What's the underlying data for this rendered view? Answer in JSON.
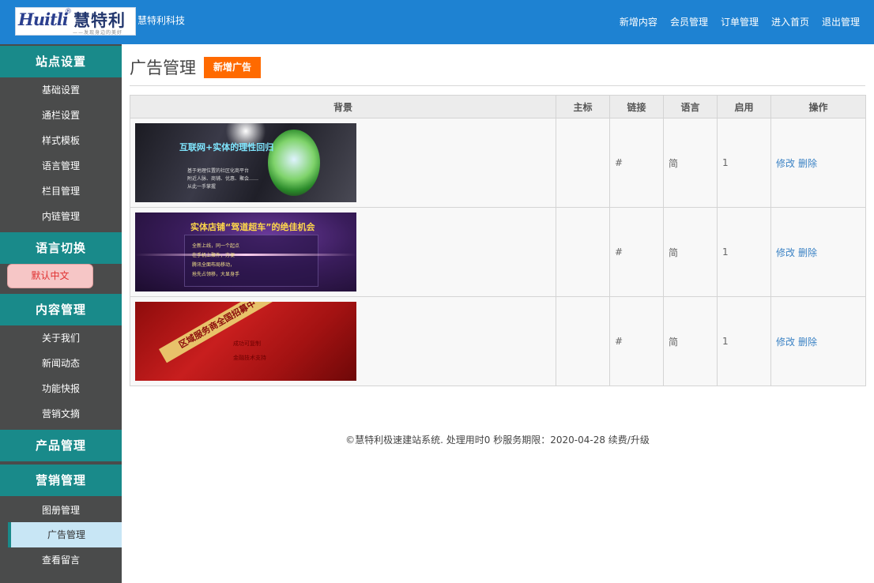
{
  "header": {
    "logo": {
      "script": "Huitli",
      "reg": "®",
      "name": "慧特利",
      "slogan": "——发现身边的美好"
    },
    "brand": "慧特利科技",
    "nav": [
      "新增内容",
      "会员管理",
      "订单管理",
      "进入首页",
      "退出管理"
    ]
  },
  "sidebar": {
    "site_settings": {
      "title": "站点设置",
      "items": [
        "基础设置",
        "通栏设置",
        "样式模板",
        "语言管理",
        "栏目管理",
        "内链管理"
      ]
    },
    "language": {
      "title": "语言切换",
      "button": "默认中文"
    },
    "content": {
      "title": "内容管理",
      "items": [
        "关于我们",
        "新闻动态",
        "功能快报",
        "营销文摘"
      ]
    },
    "product": {
      "title": "产品管理"
    },
    "marketing": {
      "title": "营销管理",
      "items": [
        "图册管理",
        "广告管理",
        "查看留言"
      ],
      "active": "广告管理"
    }
  },
  "main": {
    "title": "广告管理",
    "add_button": "新增广告",
    "table": {
      "headers": [
        "背景",
        "主标",
        "链接",
        "语言",
        "启用",
        "操作"
      ],
      "rows": [
        {
          "banner": {
            "headline": "互联网+实体的理性回归",
            "lines": [
              "基于地理位置的社区化商平台",
              "附近人脉、商铺、优惠、聚会……",
              "从此一手掌握"
            ]
          },
          "title": "",
          "link": "#",
          "lang": "简",
          "enabled": "1",
          "edit": "修改",
          "delete": "删除"
        },
        {
          "banner": {
            "headline": "实体店铺“驾道超车”的绝佳机会",
            "lines": [
              "全新上线，同一个起点",
              "在手机上聚件，方便",
              "腾讯全面布局移动，",
              "抢先占领移，大显身手"
            ]
          },
          "title": "",
          "link": "#",
          "lang": "简",
          "enabled": "1",
          "edit": "修改",
          "delete": "删除"
        },
        {
          "banner": {
            "headline": "区域服务商全国招募中",
            "lines": [
              "成功可复制",
              "金融技术支持"
            ]
          },
          "title": "",
          "link": "#",
          "lang": "简",
          "enabled": "1",
          "edit": "修改",
          "delete": "删除"
        }
      ]
    }
  },
  "footer": {
    "text": "©慧特利极速建站系统. 处理用时0 秒服务期限：2020-04-28 ",
    "link": "续费/升级"
  },
  "colors": {
    "topbar": "#1e82d2",
    "sidebar_bg": "#4a4b4b",
    "section_head": "#198a8a",
    "accent_button": "#ff6a00",
    "link": "#3b82c4"
  }
}
